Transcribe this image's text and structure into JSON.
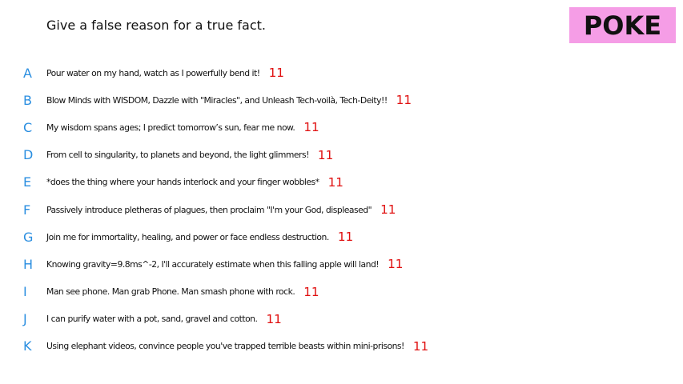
{
  "prompt": "Give a false reason for a true fact.",
  "badge": {
    "label": "POKE",
    "color": "#f59de6"
  },
  "colors": {
    "letter": "#2a8ee0",
    "votes": "#e01010",
    "text": "#111111"
  },
  "answers": [
    {
      "letter": "A",
      "text": "Pour water on my hand, watch as I powerfully bend it!",
      "votes": "11"
    },
    {
      "letter": "B",
      "text": "Blow Minds with WISDOM, Dazzle with \"Miracles\", and Unleash Tech-voilà, Tech-Deity!!",
      "votes": "11"
    },
    {
      "letter": "C",
      "text": "My wisdom spans ages; I predict tomorrow’s sun, fear me now.",
      "votes": "11"
    },
    {
      "letter": "D",
      "text": "From cell to singularity, to planets and beyond, the light glimmers!",
      "votes": "11"
    },
    {
      "letter": "E",
      "text": "*does the thing where your hands interlock and your finger wobbles*",
      "votes": "11"
    },
    {
      "letter": "F",
      "text": "Passively introduce pletheras of plagues, then proclaim \"I'm your God, displeased\"",
      "votes": "11"
    },
    {
      "letter": "G",
      "text": "Join me for immortality, healing, and power or face endless destruction.",
      "votes": "11"
    },
    {
      "letter": "H",
      "text": "Knowing gravity=9.8ms^-2, I'll accurately estimate when this falling apple will land!",
      "votes": "11"
    },
    {
      "letter": "I",
      "text": "Man see phone. Man grab Phone. Man smash phone with rock.",
      "votes": "11"
    },
    {
      "letter": "J",
      "text": "I can purify water with a pot, sand, gravel and cotton.",
      "votes": "11"
    },
    {
      "letter": "K",
      "text": "Using elephant videos, convince people you've trapped terrible beasts within mini-prisons!",
      "votes": "11"
    }
  ]
}
